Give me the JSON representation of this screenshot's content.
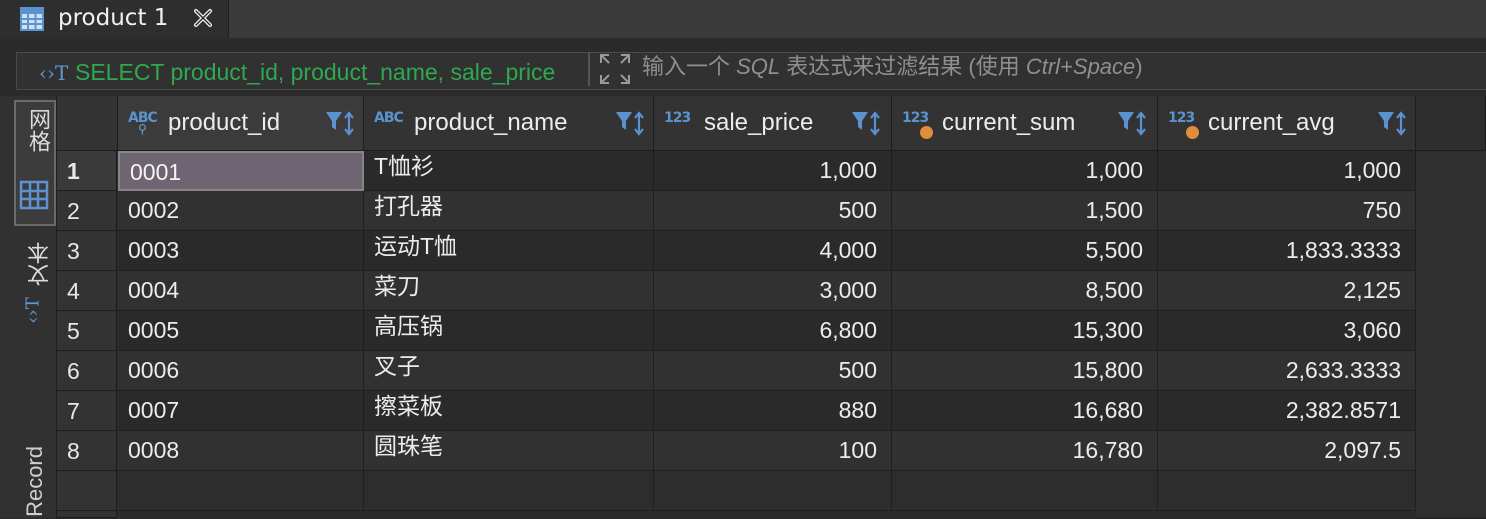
{
  "tab": {
    "title": "product 1",
    "icon": "table-icon",
    "close_icon": "close-icon"
  },
  "filter": {
    "sql": "SELECT product_id, product_name, sale_price",
    "hint_prefix": "输入一个 ",
    "hint_sql": "SQL",
    "hint_mid": " 表达式来过滤结果 (使用 ",
    "hint_key": "Ctrl+Space",
    "hint_suffix": ")"
  },
  "side": {
    "grid_label": "网格",
    "text_label": "文本",
    "record_label": "Record"
  },
  "columns": [
    {
      "type_label": "ABC",
      "name": "product_id"
    },
    {
      "type_label": "ABC",
      "name": "product_name"
    },
    {
      "type_label": "123",
      "name": "sale_price"
    },
    {
      "type_label": "123",
      "name": "current_sum"
    },
    {
      "type_label": "123",
      "name": "current_avg"
    }
  ],
  "rows": [
    {
      "n": "1",
      "product_id": "0001",
      "product_name": "T恤衫",
      "sale_price": "1,000",
      "current_sum": "1,000",
      "current_avg": "1,000"
    },
    {
      "n": "2",
      "product_id": "0002",
      "product_name": "打孔器",
      "sale_price": "500",
      "current_sum": "1,500",
      "current_avg": "750"
    },
    {
      "n": "3",
      "product_id": "0003",
      "product_name": "运动T恤",
      "sale_price": "4,000",
      "current_sum": "5,500",
      "current_avg": "1,833.3333"
    },
    {
      "n": "4",
      "product_id": "0004",
      "product_name": "菜刀",
      "sale_price": "3,000",
      "current_sum": "8,500",
      "current_avg": "2,125"
    },
    {
      "n": "5",
      "product_id": "0005",
      "product_name": "高压锅",
      "sale_price": "6,800",
      "current_sum": "15,300",
      "current_avg": "3,060"
    },
    {
      "n": "6",
      "product_id": "0006",
      "product_name": "叉子",
      "sale_price": "500",
      "current_sum": "15,800",
      "current_avg": "2,633.3333"
    },
    {
      "n": "7",
      "product_id": "0007",
      "product_name": "擦菜板",
      "sale_price": "880",
      "current_sum": "16,680",
      "current_avg": "2,382.8571"
    },
    {
      "n": "8",
      "product_id": "0008",
      "product_name": "圆珠笔",
      "sale_price": "100",
      "current_sum": "16,780",
      "current_avg": "2,097.5"
    }
  ],
  "colors": {
    "accent": "#5a93cf",
    "sql_green": "#2fa84f",
    "selection": "#6e6472",
    "calc_dot": "#e08d3c"
  }
}
